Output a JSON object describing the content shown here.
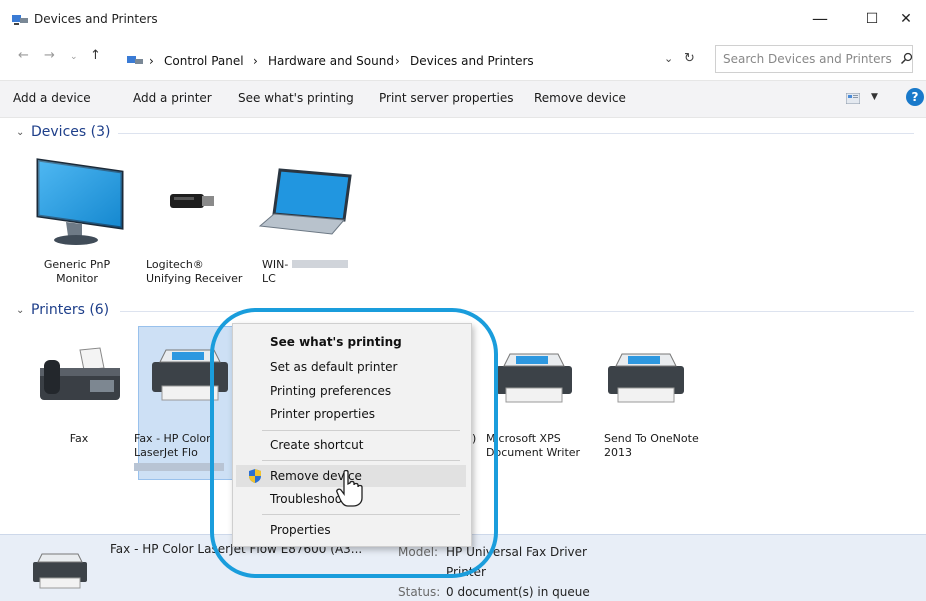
{
  "window": {
    "title": "Devices and Printers",
    "minimize": "—",
    "maximize": "☐",
    "close": "✕"
  },
  "address": {
    "crumbs": [
      "Control Panel",
      "Hardware and Sound",
      "Devices and Printers"
    ],
    "separator": "›",
    "search_placeholder": "Search Devices and Printers"
  },
  "toolbar": {
    "add_device": "Add a device",
    "add_printer": "Add a printer",
    "see_printing": "See what's printing",
    "print_server": "Print server properties",
    "remove_device": "Remove device",
    "help": "?"
  },
  "groups": {
    "devices": {
      "header": "Devices (3)",
      "items": [
        {
          "line1": "Generic PnP",
          "line2": "Monitor",
          "icon": "monitor-icon"
        },
        {
          "line1": "Logitech®",
          "line2": "Unifying Receiver",
          "icon": "usb-receiver-icon"
        },
        {
          "line1": "WIN-",
          "line2": "LC",
          "icon": "laptop-icon"
        }
      ]
    },
    "printers": {
      "header": "Printers (6)",
      "items": [
        {
          "line1": "Fax",
          "line2": "",
          "icon": "fax-icon"
        },
        {
          "line1": "Fax - HP Color",
          "line2": "LaserJet Flo",
          "icon": "printer-icon"
        },
        {
          "line1": "",
          "line2": "",
          "icon": "printer-icon"
        },
        {
          "line1": "",
          "line2": "",
          "icon": "printer-icon"
        },
        {
          "line1": "Microsoft XPS",
          "line2": "Document Writer",
          "icon": "printer-icon"
        },
        {
          "line1": "Send To OneNote",
          "line2": "2013",
          "icon": "printer-icon"
        }
      ]
    }
  },
  "context_menu": {
    "items": [
      "See what's printing",
      "Set as default printer",
      "Printing preferences",
      "Printer properties",
      "Create shortcut",
      "Remove device",
      "Troubleshoot",
      "Properties"
    ]
  },
  "details": {
    "name": "Fax - HP Color LaserJet Flow E87600 (A3...",
    "model_key": "Model:",
    "model_val": "HP Universal Fax Driver",
    "category_val": "Printer",
    "status_key": "Status:",
    "status_val": "0 document(s) in queue"
  },
  "colors": {
    "accent": "#1979ca",
    "highlight_ring": "#1a9ddc",
    "group_header": "#1e3f8a",
    "selection": "#cde0f5"
  }
}
